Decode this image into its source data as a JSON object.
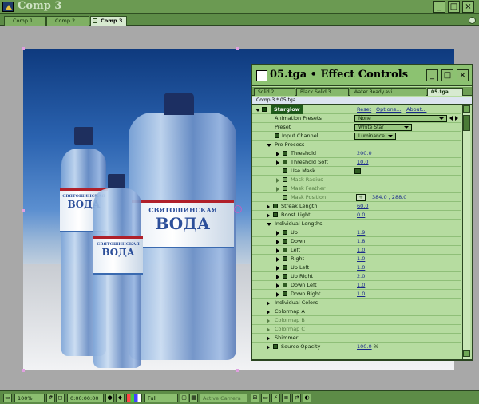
{
  "window": {
    "title": "Comp 3"
  },
  "comp_tabs": [
    {
      "label": "Comp 1"
    },
    {
      "label": "Comp 2"
    },
    {
      "label": "Comp 3"
    }
  ],
  "effect_controls": {
    "title": "05.tga • Effect Controls",
    "layer_tabs": [
      "Solid 2",
      "Black Solid 3",
      "Water Ready.avi",
      "05.tga"
    ],
    "breadcrumb": "Comp 3 * 05.tga",
    "effect_name": "Starglow",
    "effect_buttons": {
      "reset": "Reset",
      "options": "Options...",
      "about": "About..."
    },
    "animation_presets": {
      "label": "Animation Presets",
      "value": "None"
    },
    "preset": {
      "label": "Preset",
      "value": "White Star"
    },
    "input_channel": {
      "label": "Input Channel",
      "value": "Luminance"
    },
    "pre_process": "Pre-Process",
    "threshold": {
      "label": "Threshold",
      "value": "200.0"
    },
    "threshold_soft": {
      "label": "Threshold Soft",
      "value": "10.0"
    },
    "use_mask": {
      "label": "Use Mask"
    },
    "mask_radius": {
      "label": "Mask Radius"
    },
    "mask_feather": {
      "label": "Mask Feather"
    },
    "mask_position": {
      "label": "Mask Position",
      "value": "384.0 , 288.0"
    },
    "streak_length": {
      "label": "Streak Length",
      "value": "60.0"
    },
    "boost_light": {
      "label": "Boost Light",
      "value": "0.0"
    },
    "individual_lengths": "Individual Lengths",
    "lengths": [
      {
        "label": "Up",
        "value": "1.9"
      },
      {
        "label": "Down",
        "value": "1.8"
      },
      {
        "label": "Left",
        "value": "1.0"
      },
      {
        "label": "Right",
        "value": "1.0"
      },
      {
        "label": "Up Left",
        "value": "1.0"
      },
      {
        "label": "Up Right",
        "value": "2.0"
      },
      {
        "label": "Down Left",
        "value": "1.0"
      },
      {
        "label": "Down Right",
        "value": "1.0"
      }
    ],
    "individual_colors": "Individual Colors",
    "colormap_a": "Colormap A",
    "colormap_b": "Colormap B",
    "colormap_c": "Colormap C",
    "shimmer": "Shimmer",
    "source_opacity": {
      "label": "Source Opacity",
      "value": "100.0",
      "unit": "%"
    }
  },
  "bottle_label": {
    "brand": "СВЯТОШИНСКАЯ",
    "word": "ВОДА"
  },
  "status": {
    "zoom": "100%",
    "timecode": "0:00:00:00",
    "resolution": "Full",
    "camera": "Active Camera"
  }
}
